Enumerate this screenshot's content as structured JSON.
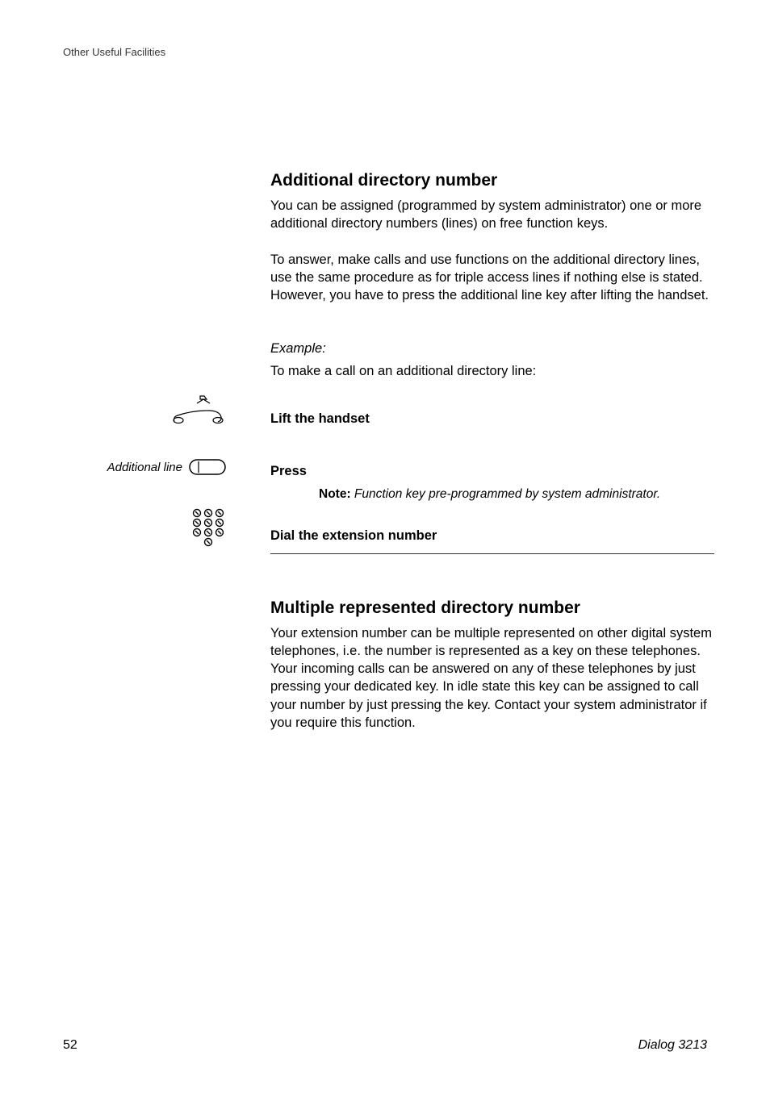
{
  "header": {
    "section": "Other Useful Facilities"
  },
  "sections": {
    "additional_directory": {
      "title": "Additional directory number",
      "para1": "You can be assigned (programmed by system administrator) one or more additional directory numbers (lines) on free function keys.",
      "para2": "To answer, make calls and use functions on the additional directory lines, use the same procedure as for triple access lines if nothing else is stated. However, you have to press the additional line key after lifting the handset.",
      "example_label": "Example:",
      "example_text": "To make a call on an additional directory line:",
      "step1": "Lift the handset",
      "additional_line_label": "Additional line",
      "step2": "Press",
      "note_label": "Note:",
      "note_text": " Function key pre-programmed by system administrator.",
      "step3": "Dial the extension number"
    },
    "multiple_represented": {
      "title": "Multiple represented directory number",
      "para": "Your extension number can be multiple represented on other digital system telephones, i.e. the number is represented as a key on these telephones. Your incoming calls can be answered on any of these telephones by just pressing your dedicated key. In idle state this key can be assigned to call your number by just pressing the key. Contact your system administrator if you require this function."
    }
  },
  "footer": {
    "page": "52",
    "model": "Dialog 3213"
  }
}
